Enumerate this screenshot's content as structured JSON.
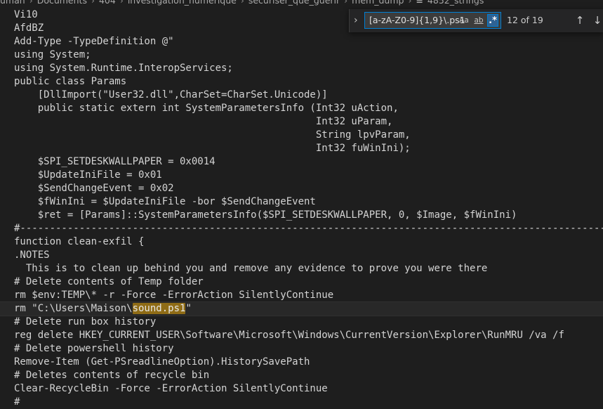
{
  "breadcrumb": {
    "items": [
      "uman",
      "Documents",
      "404",
      "investigation_numerique",
      "securiser_que_guerir",
      "mem_dump"
    ],
    "file": "4852_strings",
    "separator": "›",
    "file_icon": "≡"
  },
  "find": {
    "toggle_icon": "›",
    "query": "[a-zA-Z0-9]{1,9}\\.ps1",
    "match_case": "Aa",
    "whole_word": "ab",
    "regex": ".*",
    "count": "12 of 19",
    "prev_icon": "↑",
    "next_icon": "↓"
  },
  "editor": {
    "lines": [
      "Vi10",
      "AfdBZ",
      "Add-Type -TypeDefinition @\"",
      "using System;",
      "using System.Runtime.InteropServices;",
      "public class Params",
      "    [DllImport(\"User32.dll\",CharSet=CharSet.Unicode)]",
      "    public static extern int SystemParametersInfo (Int32 uAction,",
      "                                                   Int32 uParam,",
      "                                                   String lpvParam,",
      "                                                   Int32 fuWinIni);",
      "    $SPI_SETDESKWALLPAPER = 0x0014",
      "    $UpdateIniFile = 0x01",
      "    $SendChangeEvent = 0x02",
      "    $fWinIni = $UpdateIniFile -bor $SendChangeEvent",
      "    $ret = [Params]::SystemParametersInfo($SPI_SETDESKWALLPAPER, 0, $Image, $fWinIni)",
      "#-------------------------------------------------------------------------------------------------------",
      "function clean-exfil {",
      ".NOTES",
      "  This is to clean up behind you and remove any evidence to prove you were there",
      "# Delete contents of Temp folder",
      "rm $env:TEMP\\* -r -Force -ErrorAction SilentlyContinue"
    ],
    "match_line": {
      "before": "rm \"C:\\Users\\Maison\\",
      "match": "sound.ps1",
      "after": "\""
    },
    "lines_after": [
      "# Delete run box history",
      "reg delete HKEY_CURRENT_USER\\Software\\Microsoft\\Windows\\CurrentVersion\\Explorer\\RunMRU /va /f",
      "# Delete powershell history",
      "Remove-Item (Get-PSreadlineOption).HistorySavePath",
      "# Deletes contents of recycle bin",
      "Clear-RecycleBin -Force -ErrorAction SilentlyContinue",
      "#"
    ]
  }
}
